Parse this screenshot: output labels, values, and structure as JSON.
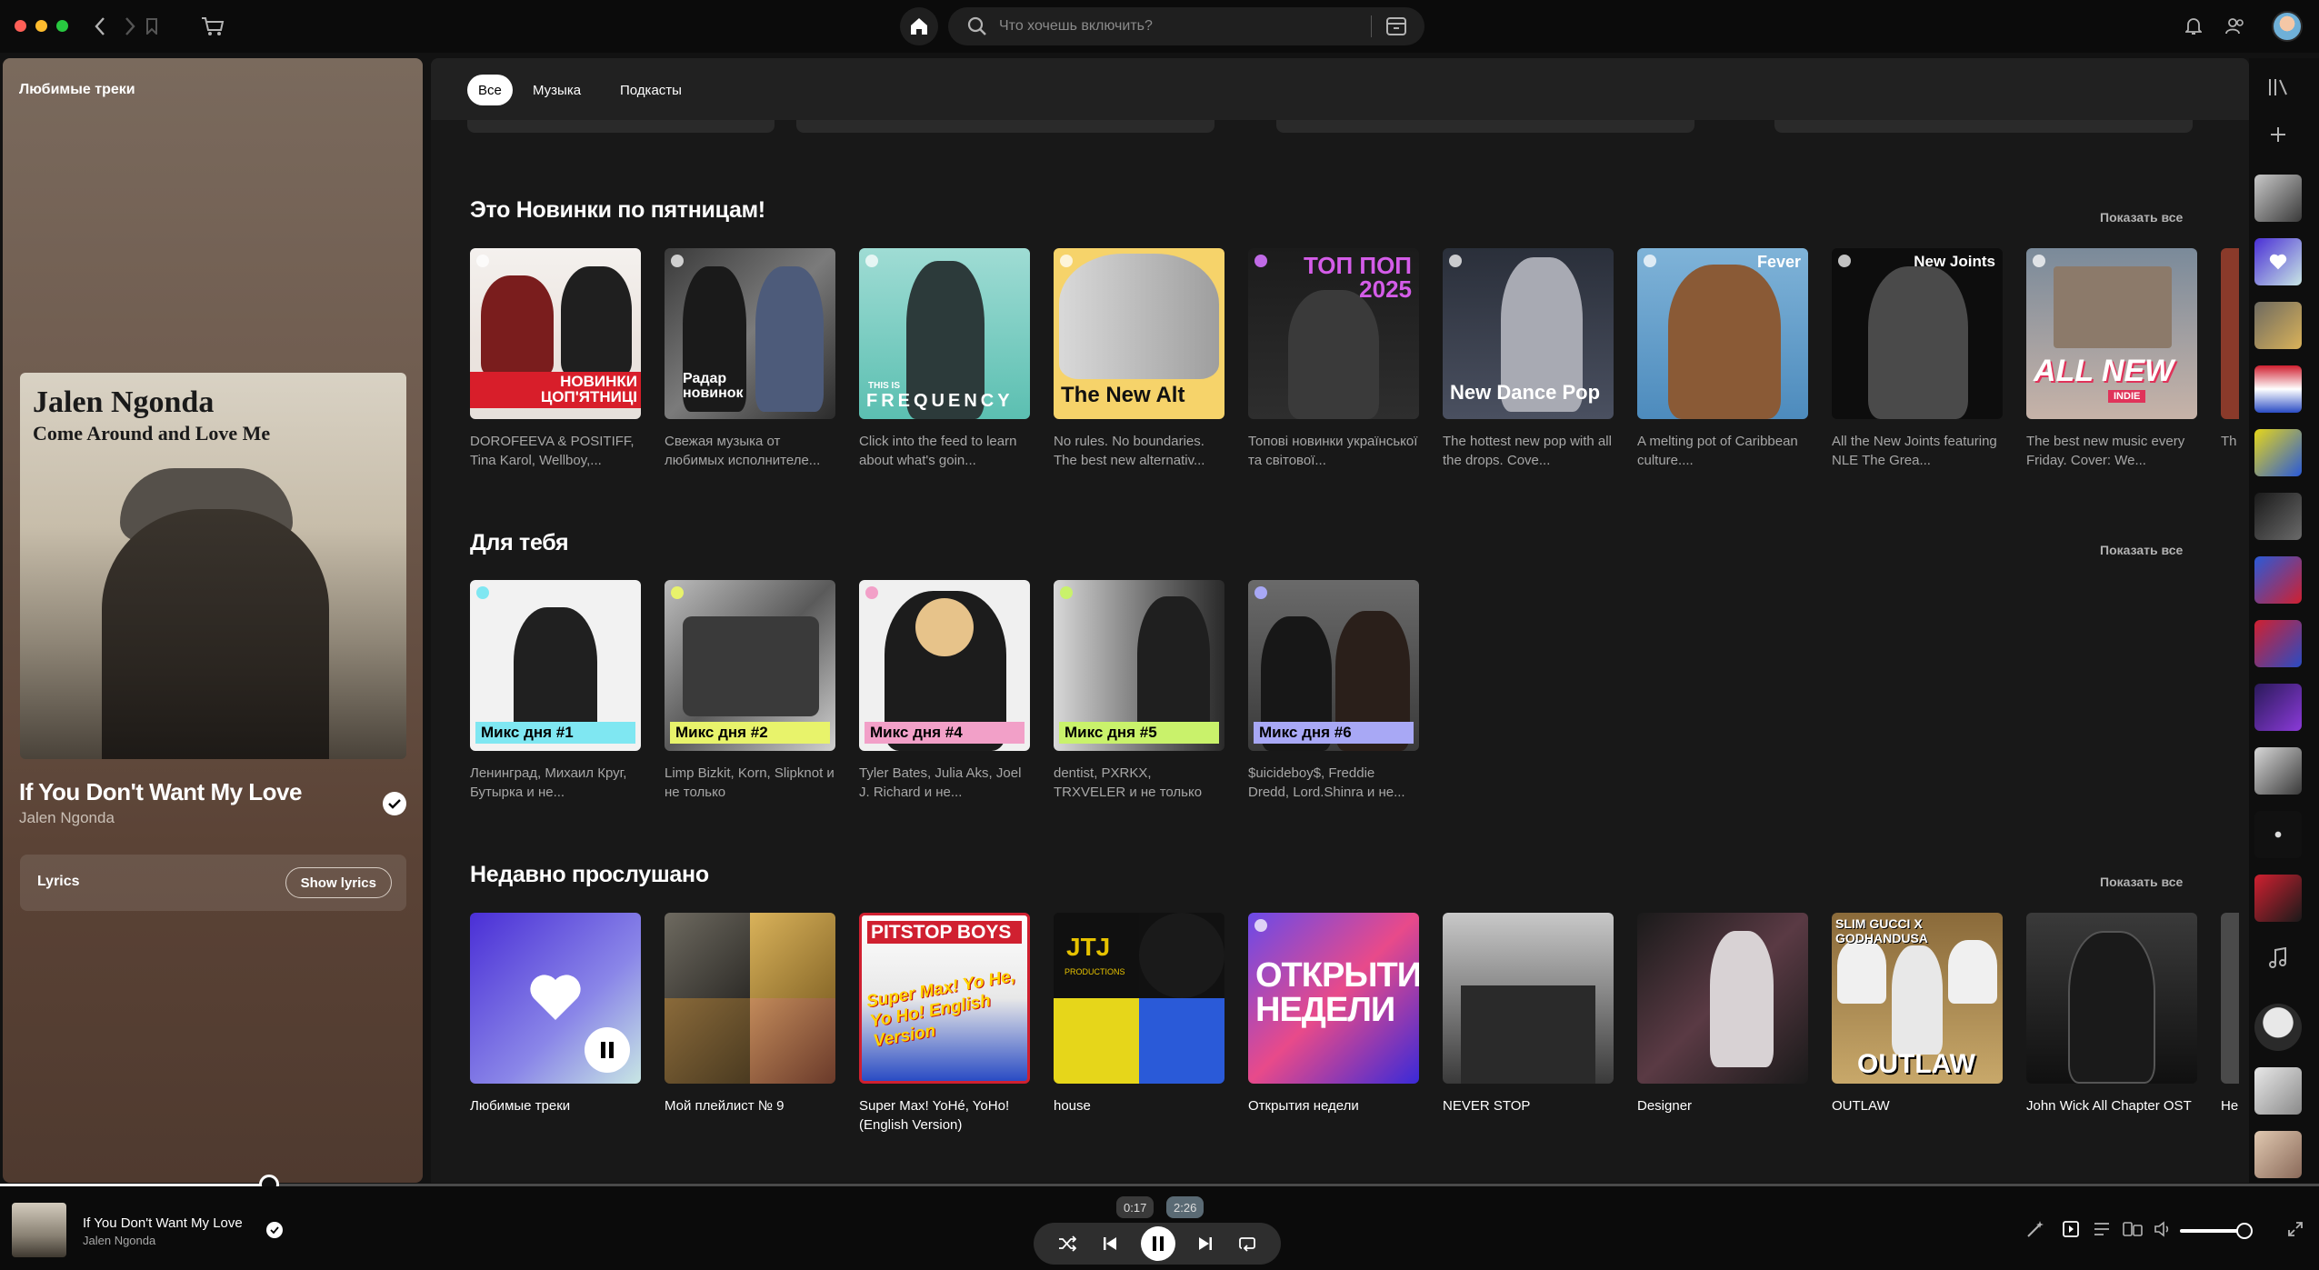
{
  "topbar": {
    "search_placeholder": "Что хочешь включить?"
  },
  "left_panel": {
    "title": "Любимые треки",
    "cover_artist": "Jalen Ngonda",
    "cover_album": "Come Around and Love Me",
    "song": "If You Don't Want My Love",
    "artist": "Jalen Ngonda",
    "lyrics_label": "Lyrics",
    "show_lyrics": "Show lyrics"
  },
  "filters": {
    "all": "Все",
    "music": "Музыка",
    "podcasts": "Подкасты"
  },
  "sections": {
    "friday": {
      "title": "Это Новинки по пятницам!",
      "show_all": "Показать все",
      "cards": [
        {
          "overlay": "НОВИНКИ ЦОП'ЯТНИЦІ",
          "desc": "DOROFEEVA & POSITIFF, Tina Karol, Wellboy,..."
        },
        {
          "overlay": "Радар новинок",
          "desc": "Свежая музыка от любимых исполнителе..."
        },
        {
          "overlay": "FREQUENCY",
          "overlay_small": "THIS IS",
          "desc": "Click into the feed to learn about what's goin..."
        },
        {
          "overlay": "The New Alt",
          "desc": "No rules. No boundaries. The best new alternativ..."
        },
        {
          "overlay": "ТОП ПОП 2025",
          "desc": "Топові новинки української та світової..."
        },
        {
          "overlay": "New Dance Pop",
          "desc": "The hottest new pop with all the drops. Cove..."
        },
        {
          "overlay": "Fever",
          "desc": "A melting pot of Caribbean culture...."
        },
        {
          "overlay": "New Joints",
          "desc": "All the New Joints featuring NLE The Grea..."
        },
        {
          "overlay": "ALL NEW",
          "overlay_small": "INDIE",
          "desc": "The best new music every Friday. Cover: We..."
        }
      ],
      "partial_desc": "Th ev"
    },
    "for_you": {
      "title": "Для тебя",
      "show_all": "Показать все",
      "cards": [
        {
          "mix": "Микс дня #1",
          "strip_color": "#7fe7f2",
          "desc": "Ленинград, Михаил Круг, Бутырка и не..."
        },
        {
          "mix": "Микс дня #2",
          "strip_color": "#e8f36b",
          "desc": "Limp Bizkit, Korn, Slipknot и не только"
        },
        {
          "mix": "Микс дня #4",
          "strip_color": "#f2a0c8",
          "desc": "Tyler Bates, Julia Aks, Joel J. Richard и не..."
        },
        {
          "mix": "Микс дня #5",
          "strip_color": "#c9f26b",
          "desc": "dentist, PXRKX, TRXVELER и не только"
        },
        {
          "mix": "Микс дня #6",
          "strip_color": "#a8a8f5",
          "desc": "$uicideboy$, Freddie Dredd, Lord.Shinra и не..."
        }
      ]
    },
    "recent": {
      "title": "Недавно прослушано",
      "show_all": "Показать все",
      "cards": [
        {
          "label": "Любимые треки"
        },
        {
          "label": "Мой плейлист № 9"
        },
        {
          "label": "Super Max! YoHé, YoHo! (English Version)",
          "overlay": "PITSTOP BOYS",
          "overlay_small": "Super Max! Yo He, Yo Ho! English Version"
        },
        {
          "label": "house",
          "overlay": "JTJ",
          "overlay_small": "PRODUCTIONS"
        },
        {
          "label": "Открытия недели",
          "overlay": "ОТКРЫТИЯ НЕДЕЛИ"
        },
        {
          "label": "NEVER STOP"
        },
        {
          "label": "Designer"
        },
        {
          "label": "OUTLAW",
          "overlay": "SLIM GUCCI X GODHANDUSA",
          "overlay_small": "OUTLAW"
        },
        {
          "label": "John Wick All Chapter OST"
        }
      ],
      "partial_label": "He"
    }
  },
  "player": {
    "title": "If You Don't Want My Love",
    "artist": "Jalen Ngonda",
    "elapsed": "0:17",
    "duration": "2:26",
    "progress_fraction": 0.116,
    "volume_fraction": 0.9
  },
  "colors": {
    "accent_green": "#1ed760",
    "background": "#121212"
  }
}
